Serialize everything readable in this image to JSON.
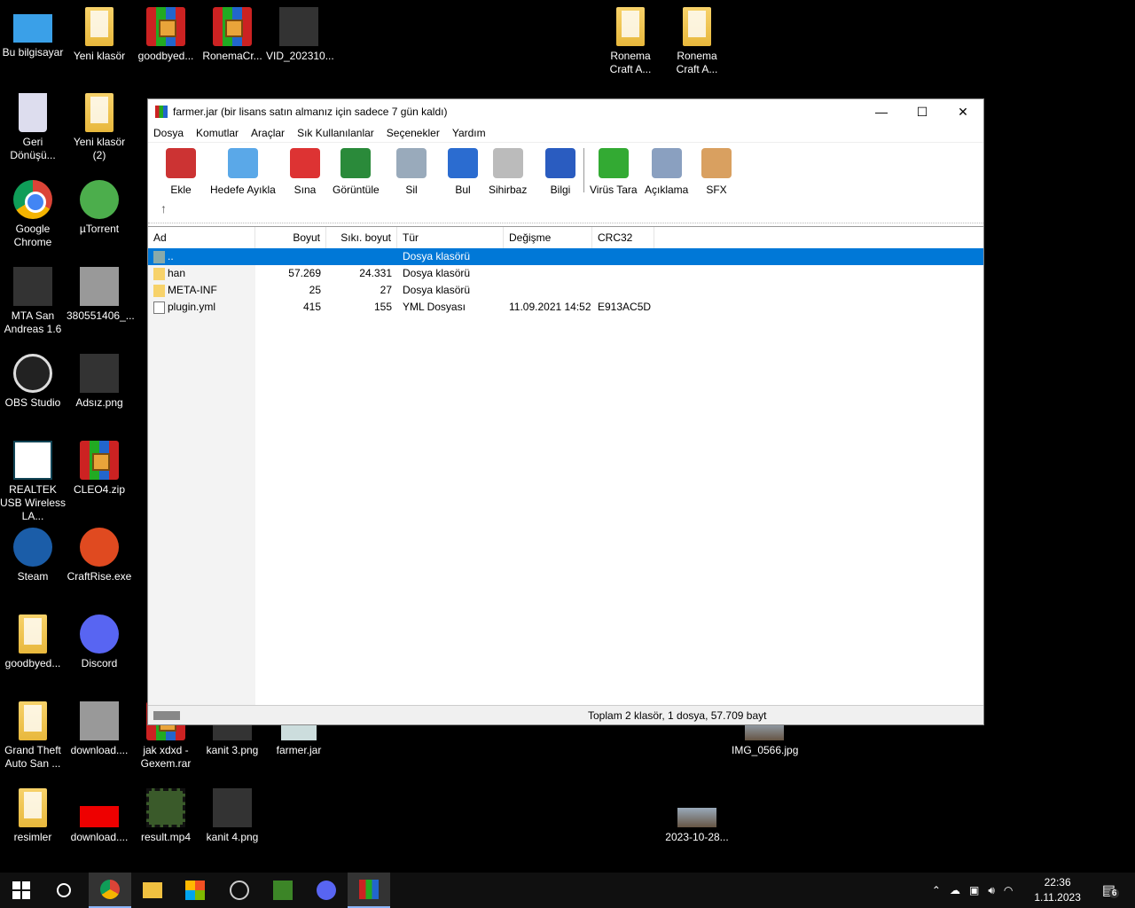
{
  "desktop": {
    "icons": [
      {
        "label": "Bu bilgisayar",
        "type": "pc"
      },
      {
        "label": "Yeni klasör",
        "type": "folder"
      },
      {
        "label": "goodbyed...",
        "type": "rar"
      },
      {
        "label": "RonemaCr...",
        "type": "rar"
      },
      {
        "label": "VID_202310...",
        "type": "dark"
      },
      {
        "label": "Ronema Craft A...",
        "type": "folder"
      },
      {
        "label": "Ronema Craft A...",
        "type": "folder"
      },
      {
        "label": "Geri Dönüşü...",
        "type": "bin"
      },
      {
        "label": "Yeni klasör (2)",
        "type": "folder"
      },
      {
        "label": "Google Chrome",
        "type": "chrome"
      },
      {
        "label": "µTorrent",
        "type": "utorrent"
      },
      {
        "label": "MTA San Andreas 1.6",
        "type": "dark"
      },
      {
        "label": "380551406_...",
        "type": "photo"
      },
      {
        "label": "OBS Studio",
        "type": "obs"
      },
      {
        "label": "Adsız.png",
        "type": "dark"
      },
      {
        "label": "REALTEK USB Wireless LA...",
        "type": "realtek"
      },
      {
        "label": "CLEO4.zip",
        "type": "rar"
      },
      {
        "label": "Steam",
        "type": "steam"
      },
      {
        "label": "CraftRise.exe",
        "type": "craft"
      },
      {
        "label": "goodbyed...",
        "type": "folder"
      },
      {
        "label": "Discord",
        "type": "discord"
      },
      {
        "label": "Grand Theft Auto San ...",
        "type": "folder"
      },
      {
        "label": "download....",
        "type": "photo"
      },
      {
        "label": "jak xdxd - Gexem.rar",
        "type": "rar"
      },
      {
        "label": "kanit 3.png",
        "type": "dark"
      },
      {
        "label": "farmer.jar",
        "type": "jar"
      },
      {
        "label": "IMG_0566.jpg",
        "type": "landscape"
      },
      {
        "label": "resimler",
        "type": "folder"
      },
      {
        "label": "download....",
        "type": "red"
      },
      {
        "label": "result.mp4",
        "type": "video"
      },
      {
        "label": "kanit 4.png",
        "type": "dark"
      },
      {
        "label": "2023-10-28...",
        "type": "landscape"
      }
    ]
  },
  "window": {
    "title": "farmer.jar (bir lisans satın almanız için sadece 7 gün kaldı)",
    "controls": [
      "—",
      "☐",
      "✕"
    ],
    "menu": [
      "Dosya",
      "Komutlar",
      "Araçlar",
      "Sık Kullanılanlar",
      "Seçenekler",
      "Yardım"
    ],
    "toolbar": [
      {
        "label": "Ekle",
        "color": "#c33"
      },
      {
        "label": "Hedefe Ayıkla",
        "color": "#5aa8e8"
      },
      {
        "label": "Sına",
        "color": "#d33"
      },
      {
        "label": "Görüntüle",
        "color": "#2a8a3a"
      },
      {
        "label": "Sil",
        "color": "#9ab"
      },
      {
        "label": "Bul",
        "color": "#2b6cd0"
      },
      {
        "label": "Sihirbaz",
        "color": "#bbb"
      },
      {
        "label": "Bilgi",
        "color": "#2a5cc0"
      },
      {
        "label": "Virüs Tara",
        "color": "#3a3"
      },
      {
        "label": "Açıklama",
        "color": "#8aa0c0"
      },
      {
        "label": "SFX",
        "color": "#d9a060"
      }
    ],
    "columns": [
      "Ad",
      "Boyut",
      "Sıkı. boyut",
      "Tür",
      "Değişme",
      "CRC32"
    ],
    "rows": [
      {
        "name": "..",
        "size": "",
        "packed": "",
        "type": "Dosya klasörü",
        "modified": "",
        "crc": "",
        "icon": "up-folder",
        "selected": true
      },
      {
        "name": "han",
        "size": "57.269",
        "packed": "24.331",
        "type": "Dosya klasörü",
        "modified": "",
        "crc": "",
        "icon": "folder"
      },
      {
        "name": "META-INF",
        "size": "25",
        "packed": "27",
        "type": "Dosya klasörü",
        "modified": "",
        "crc": "",
        "icon": "folder"
      },
      {
        "name": "plugin.yml",
        "size": "415",
        "packed": "155",
        "type": "YML Dosyası",
        "modified": "11.09.2021 14:52",
        "crc": "E913AC5D",
        "icon": "file"
      }
    ],
    "status": "Toplam 2 klasör, 1 dosya, 57.709 bayt"
  },
  "taskbar": {
    "time": "22:36",
    "date": "1.11.2023",
    "notifications": "6"
  }
}
